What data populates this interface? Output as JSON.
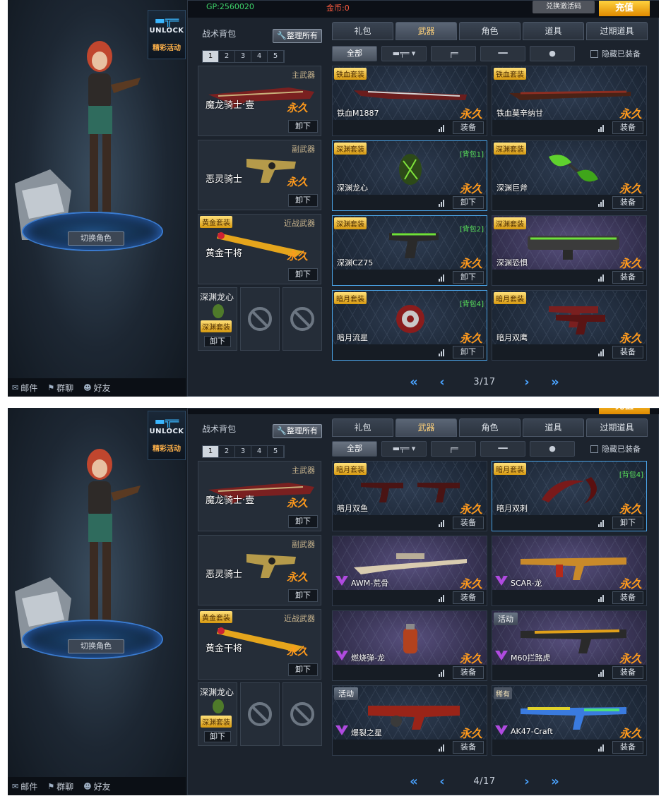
{
  "panels": [
    {
      "topbar": {
        "gp": "GP:2560020",
        "gold": "金币:0",
        "redeem": "兑换激活码",
        "recharge": "充值"
      },
      "sidebar": {
        "unlock": "UNLOCK",
        "event": "精彩活动",
        "switch_role": "切换角色",
        "mail": "邮件",
        "group_chat": "群聊",
        "friends": "好友"
      },
      "bag": {
        "title": "战术背包",
        "sort": "整理所有",
        "pages": [
          "1",
          "2",
          "3",
          "4",
          "5"
        ],
        "primary": {
          "category": "主武器",
          "name": "魔龙骑士·壹",
          "perm": "永久",
          "action": "卸下"
        },
        "secondary": {
          "category": "副武器",
          "name": "恶灵骑士",
          "perm": "永久",
          "action": "卸下"
        },
        "melee": {
          "tag": "黄金套装",
          "category": "近战武器",
          "name": "黄金干将",
          "perm": "永久",
          "action": "卸下"
        },
        "grenade": {
          "name": "深渊龙心",
          "tag": "深渊套装",
          "action": "卸下"
        }
      },
      "tabs": [
        "礼包",
        "武器",
        "角色",
        "道具",
        "过期道具"
      ],
      "filters": {
        "all": "全部",
        "hide": "隐藏已装备"
      },
      "items": [
        {
          "tag": "铁血套装",
          "name": "铁血M1887",
          "perm": "永久",
          "action": "装备",
          "bag": ""
        },
        {
          "tag": "铁血套装",
          "name": "铁血莫辛纳甘",
          "perm": "永久",
          "action": "装备",
          "bag": ""
        },
        {
          "tag": "深渊套装",
          "name": "深渊龙心",
          "perm": "永久",
          "action": "卸下",
          "bag": "[背包1]"
        },
        {
          "tag": "深渊套装",
          "name": "深渊巨斧",
          "perm": "永久",
          "action": "装备",
          "bag": ""
        },
        {
          "tag": "深渊套装",
          "name": "深渊CZ75",
          "perm": "永久",
          "action": "卸下",
          "bag": "[背包2]"
        },
        {
          "tag": "深渊套装",
          "name": "深渊恐惧",
          "perm": "永久",
          "action": "装备",
          "bag": ""
        },
        {
          "tag": "暗月套装",
          "name": "暗月流星",
          "perm": "永久",
          "action": "卸下",
          "bag": "[背包4]"
        },
        {
          "tag": "暗月套装",
          "name": "暗月双鹰",
          "perm": "永久",
          "action": "装备",
          "bag": ""
        }
      ],
      "page": "3/17"
    },
    {
      "topbar": {
        "gp": "",
        "gold": "",
        "redeem": "",
        "recharge": "充值"
      },
      "sidebar": {
        "unlock": "UNLOCK",
        "event": "精彩活动",
        "switch_role": "切换角色",
        "mail": "邮件",
        "group_chat": "群聊",
        "friends": "好友"
      },
      "bag": {
        "title": "战术背包",
        "sort": "整理所有",
        "pages": [
          "1",
          "2",
          "3",
          "4",
          "5"
        ],
        "primary": {
          "category": "主武器",
          "name": "魔龙骑士·壹",
          "perm": "永久",
          "action": "卸下"
        },
        "secondary": {
          "category": "副武器",
          "name": "恶灵骑士",
          "perm": "永久",
          "action": "卸下"
        },
        "melee": {
          "tag": "黄金套装",
          "category": "近战武器",
          "name": "黄金干将",
          "perm": "永久",
          "action": "卸下"
        },
        "grenade": {
          "name": "深渊龙心",
          "tag": "深渊套装",
          "action": "卸下"
        }
      },
      "tabs": [
        "礼包",
        "武器",
        "角色",
        "道具",
        "过期道具"
      ],
      "filters": {
        "all": "全部",
        "hide": "隐藏已装备"
      },
      "items": [
        {
          "tag": "暗月套装",
          "name": "暗月双鱼",
          "perm": "永久",
          "action": "装备",
          "bag": ""
        },
        {
          "tag": "暗月套装",
          "name": "暗月双刺",
          "perm": "永久",
          "action": "卸下",
          "bag": "[背包4]"
        },
        {
          "tag": "",
          "name": "AWM-荒骨",
          "perm": "永久",
          "action": "装备",
          "bag": ""
        },
        {
          "tag": "",
          "name": "SCAR-龙",
          "perm": "永久",
          "action": "装备",
          "bag": ""
        },
        {
          "tag": "",
          "name": "燃烧弹-龙",
          "perm": "永久",
          "action": "装备",
          "bag": ""
        },
        {
          "tag": "活动",
          "name": "M60拦路虎",
          "perm": "永久",
          "action": "装备",
          "bag": ""
        },
        {
          "tag": "活动",
          "name": "爆裂之星",
          "perm": "永久",
          "action": "装备",
          "bag": ""
        },
        {
          "tag": "稀有",
          "name": "AK47-Craft",
          "perm": "永久",
          "action": "装备",
          "bag": ""
        }
      ],
      "page": "4/17"
    }
  ],
  "colors": {
    "accent": "#4aa3ff",
    "permanent": "#ff9a1c",
    "gp": "#3fd36a",
    "gold": "#ff5c40",
    "bag_label": "#58e05a",
    "suit_tag": "#d79a10"
  }
}
